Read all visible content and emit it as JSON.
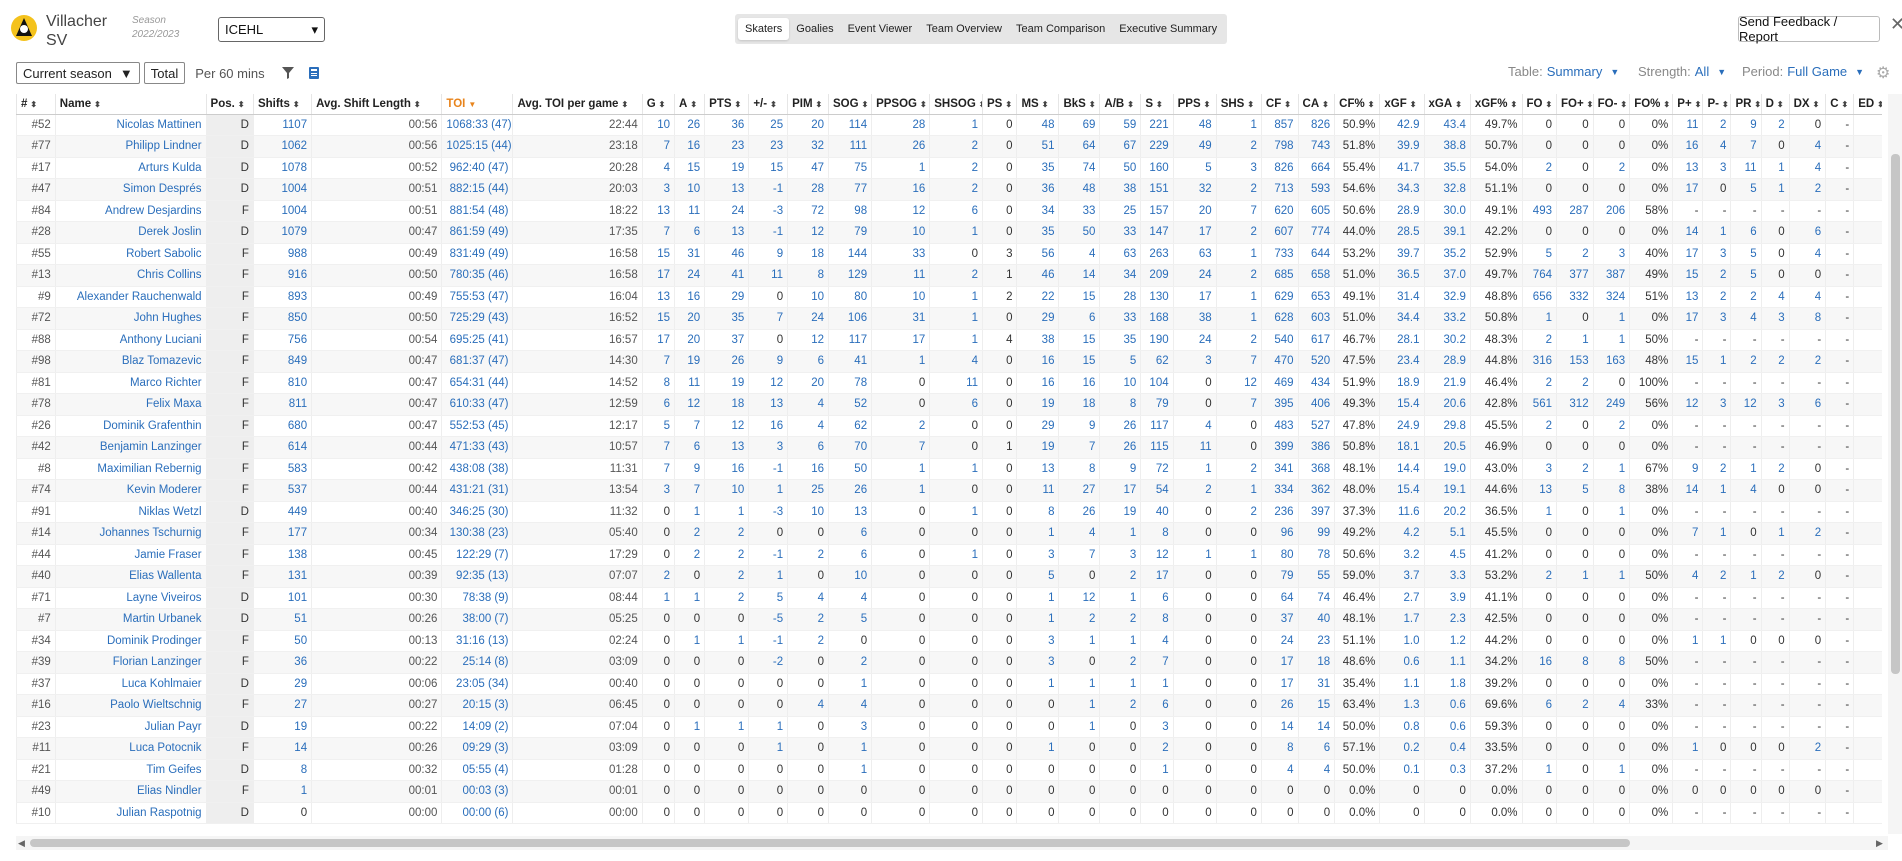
{
  "header": {
    "team_line1": "Villacher",
    "team_line2": "SV",
    "season_label": "Season",
    "season_value": "2022/2023",
    "league": "ICEHL",
    "tabs": [
      "Skaters",
      "Goalies",
      "Event Viewer",
      "Team Overview",
      "Team Comparison",
      "Executive Summary"
    ],
    "active_tab": "Skaters",
    "feedback": "Send Feedback / Report",
    "close": "✕"
  },
  "toolbar": {
    "season_filter": "Current season",
    "total": "Total",
    "per60": "Per 60 mins",
    "table_label": "Table:",
    "table_value": "Summary",
    "strength_label": "Strength:",
    "strength_value": "All",
    "period_label": "Period:",
    "period_value": "Full Game"
  },
  "columns": [
    "#",
    "Name",
    "Pos.",
    "Shifts",
    "Avg. Shift Length",
    "TOI",
    "Avg. TOI per game",
    "G",
    "A",
    "PTS",
    "+/-",
    "PIM",
    "SOG",
    "PPSOG",
    "SHSOG",
    "PS",
    "MS",
    "BkS",
    "A/B",
    "S",
    "PPS",
    "SHS",
    "CF",
    "CA",
    "CF%",
    "xGF",
    "xGA",
    "xGF%",
    "FO",
    "FO+",
    "FO-",
    "FO%",
    "P+",
    "P-",
    "PR",
    "D",
    "DX",
    "C",
    "ED"
  ],
  "rows": [
    [
      "#52",
      "Nicolas Mattinen",
      "D",
      "1107",
      "00:56",
      "1068:33 (47)",
      "22:44",
      "10",
      "26",
      "36",
      "25",
      "20",
      "114",
      "28",
      "1",
      "0",
      "48",
      "69",
      "59",
      "221",
      "48",
      "1",
      "857",
      "826",
      "50.9%",
      "42.9",
      "43.4",
      "49.7%",
      "0",
      "0",
      "0",
      "0%",
      "11",
      "2",
      "9",
      "2",
      "0",
      "-",
      ""
    ],
    [
      "#77",
      "Philipp Lindner",
      "D",
      "1062",
      "00:56",
      "1025:15 (44)",
      "23:18",
      "7",
      "16",
      "23",
      "23",
      "32",
      "111",
      "26",
      "2",
      "0",
      "51",
      "64",
      "67",
      "229",
      "49",
      "2",
      "798",
      "743",
      "51.8%",
      "39.9",
      "38.8",
      "50.7%",
      "0",
      "0",
      "0",
      "0%",
      "16",
      "4",
      "7",
      "0",
      "4",
      "-",
      ""
    ],
    [
      "#17",
      "Arturs Kulda",
      "D",
      "1078",
      "00:52",
      "962:40 (47)",
      "20:28",
      "4",
      "15",
      "19",
      "15",
      "47",
      "75",
      "1",
      "2",
      "0",
      "35",
      "74",
      "50",
      "160",
      "5",
      "3",
      "826",
      "664",
      "55.4%",
      "41.7",
      "35.5",
      "54.0%",
      "2",
      "0",
      "2",
      "0%",
      "13",
      "3",
      "11",
      "1",
      "4",
      "-",
      ""
    ],
    [
      "#47",
      "Simon Després",
      "D",
      "1004",
      "00:51",
      "882:15 (44)",
      "20:03",
      "3",
      "10",
      "13",
      "-1",
      "28",
      "77",
      "16",
      "2",
      "0",
      "36",
      "48",
      "38",
      "151",
      "32",
      "2",
      "713",
      "593",
      "54.6%",
      "34.3",
      "32.8",
      "51.1%",
      "0",
      "0",
      "0",
      "0%",
      "17",
      "0",
      "5",
      "1",
      "2",
      "-",
      ""
    ],
    [
      "#84",
      "Andrew Desjardins",
      "F",
      "1004",
      "00:51",
      "881:54 (48)",
      "18:22",
      "13",
      "11",
      "24",
      "-3",
      "72",
      "98",
      "12",
      "6",
      "0",
      "34",
      "33",
      "25",
      "157",
      "20",
      "7",
      "620",
      "605",
      "50.6%",
      "28.9",
      "30.0",
      "49.1%",
      "493",
      "287",
      "206",
      "58%",
      "-",
      "-",
      "-",
      "-",
      "-",
      "-",
      ""
    ],
    [
      "#28",
      "Derek Joslin",
      "D",
      "1079",
      "00:47",
      "861:59 (49)",
      "17:35",
      "7",
      "6",
      "13",
      "-1",
      "12",
      "79",
      "10",
      "1",
      "0",
      "35",
      "50",
      "33",
      "147",
      "17",
      "2",
      "607",
      "774",
      "44.0%",
      "28.5",
      "39.1",
      "42.2%",
      "0",
      "0",
      "0",
      "0%",
      "14",
      "1",
      "6",
      "0",
      "6",
      "-",
      ""
    ],
    [
      "#55",
      "Robert Sabolic",
      "F",
      "988",
      "00:49",
      "831:49 (49)",
      "16:58",
      "15",
      "31",
      "46",
      "9",
      "18",
      "144",
      "33",
      "0",
      "3",
      "56",
      "4",
      "63",
      "263",
      "63",
      "1",
      "733",
      "644",
      "53.2%",
      "39.7",
      "35.2",
      "52.9%",
      "5",
      "2",
      "3",
      "40%",
      "17",
      "3",
      "5",
      "0",
      "4",
      "-",
      ""
    ],
    [
      "#13",
      "Chris Collins",
      "F",
      "916",
      "00:50",
      "780:35 (46)",
      "16:58",
      "17",
      "24",
      "41",
      "11",
      "8",
      "129",
      "11",
      "2",
      "1",
      "46",
      "14",
      "34",
      "209",
      "24",
      "2",
      "685",
      "658",
      "51.0%",
      "36.5",
      "37.0",
      "49.7%",
      "764",
      "377",
      "387",
      "49%",
      "15",
      "2",
      "5",
      "0",
      "0",
      "-",
      ""
    ],
    [
      "#9",
      "Alexander Rauchenwald",
      "F",
      "893",
      "00:49",
      "755:53 (47)",
      "16:04",
      "13",
      "16",
      "29",
      "0",
      "10",
      "80",
      "10",
      "1",
      "2",
      "22",
      "15",
      "28",
      "130",
      "17",
      "1",
      "629",
      "653",
      "49.1%",
      "31.4",
      "32.9",
      "48.8%",
      "656",
      "332",
      "324",
      "51%",
      "13",
      "2",
      "2",
      "4",
      "4",
      "-",
      ""
    ],
    [
      "#72",
      "John Hughes",
      "F",
      "850",
      "00:50",
      "725:29 (43)",
      "16:52",
      "15",
      "20",
      "35",
      "7",
      "24",
      "106",
      "31",
      "1",
      "0",
      "29",
      "6",
      "33",
      "168",
      "38",
      "1",
      "628",
      "603",
      "51.0%",
      "34.4",
      "33.2",
      "50.8%",
      "1",
      "0",
      "1",
      "0%",
      "17",
      "3",
      "4",
      "3",
      "8",
      "-",
      ""
    ],
    [
      "#88",
      "Anthony Luciani",
      "F",
      "756",
      "00:54",
      "695:25 (41)",
      "16:57",
      "17",
      "20",
      "37",
      "0",
      "12",
      "117",
      "17",
      "1",
      "4",
      "38",
      "15",
      "35",
      "190",
      "24",
      "2",
      "540",
      "617",
      "46.7%",
      "28.1",
      "30.2",
      "48.3%",
      "2",
      "1",
      "1",
      "50%",
      "-",
      "-",
      "-",
      "-",
      "-",
      "-",
      ""
    ],
    [
      "#98",
      "Blaz Tomazevic",
      "F",
      "849",
      "00:47",
      "681:37 (47)",
      "14:30",
      "7",
      "19",
      "26",
      "9",
      "6",
      "41",
      "1",
      "4",
      "0",
      "16",
      "15",
      "5",
      "62",
      "3",
      "7",
      "470",
      "520",
      "47.5%",
      "23.4",
      "28.9",
      "44.8%",
      "316",
      "153",
      "163",
      "48%",
      "15",
      "1",
      "2",
      "2",
      "2",
      "-",
      ""
    ],
    [
      "#81",
      "Marco Richter",
      "F",
      "810",
      "00:47",
      "654:31 (44)",
      "14:52",
      "8",
      "11",
      "19",
      "12",
      "20",
      "78",
      "0",
      "11",
      "0",
      "16",
      "16",
      "10",
      "104",
      "0",
      "12",
      "469",
      "434",
      "51.9%",
      "18.9",
      "21.9",
      "46.4%",
      "2",
      "2",
      "0",
      "100%",
      "-",
      "-",
      "-",
      "-",
      "-",
      "-",
      ""
    ],
    [
      "#78",
      "Felix Maxa",
      "F",
      "811",
      "00:47",
      "610:33 (47)",
      "12:59",
      "6",
      "12",
      "18",
      "13",
      "4",
      "52",
      "0",
      "6",
      "0",
      "19",
      "18",
      "8",
      "79",
      "0",
      "7",
      "395",
      "406",
      "49.3%",
      "15.4",
      "20.6",
      "42.8%",
      "561",
      "312",
      "249",
      "56%",
      "12",
      "3",
      "12",
      "3",
      "6",
      "-",
      ""
    ],
    [
      "#26",
      "Dominik Grafenthin",
      "F",
      "680",
      "00:47",
      "552:53 (45)",
      "12:17",
      "5",
      "7",
      "12",
      "16",
      "4",
      "62",
      "2",
      "0",
      "0",
      "29",
      "9",
      "26",
      "117",
      "4",
      "0",
      "483",
      "527",
      "47.8%",
      "24.9",
      "29.8",
      "45.5%",
      "2",
      "0",
      "2",
      "0%",
      "-",
      "-",
      "-",
      "-",
      "-",
      "-",
      ""
    ],
    [
      "#42",
      "Benjamin Lanzinger",
      "F",
      "614",
      "00:44",
      "471:33 (43)",
      "10:57",
      "7",
      "6",
      "13",
      "3",
      "6",
      "70",
      "7",
      "0",
      "1",
      "19",
      "7",
      "26",
      "115",
      "11",
      "0",
      "399",
      "386",
      "50.8%",
      "18.1",
      "20.5",
      "46.9%",
      "0",
      "0",
      "0",
      "0%",
      "-",
      "-",
      "-",
      "-",
      "-",
      "-",
      ""
    ],
    [
      "#8",
      "Maximilian Rebernig",
      "F",
      "583",
      "00:42",
      "438:08 (38)",
      "11:31",
      "7",
      "9",
      "16",
      "-1",
      "16",
      "50",
      "1",
      "1",
      "0",
      "13",
      "8",
      "9",
      "72",
      "1",
      "2",
      "341",
      "368",
      "48.1%",
      "14.4",
      "19.0",
      "43.0%",
      "3",
      "2",
      "1",
      "67%",
      "9",
      "2",
      "1",
      "2",
      "0",
      "-",
      ""
    ],
    [
      "#74",
      "Kevin Moderer",
      "F",
      "537",
      "00:44",
      "431:21 (31)",
      "13:54",
      "3",
      "7",
      "10",
      "1",
      "25",
      "26",
      "1",
      "0",
      "0",
      "11",
      "27",
      "17",
      "54",
      "2",
      "1",
      "334",
      "362",
      "48.0%",
      "15.4",
      "19.1",
      "44.6%",
      "13",
      "5",
      "8",
      "38%",
      "14",
      "1",
      "4",
      "0",
      "0",
      "-",
      ""
    ],
    [
      "#91",
      "Niklas Wetzl",
      "D",
      "449",
      "00:40",
      "346:25 (30)",
      "11:32",
      "0",
      "1",
      "1",
      "-3",
      "10",
      "13",
      "0",
      "1",
      "0",
      "8",
      "26",
      "19",
      "40",
      "0",
      "2",
      "236",
      "397",
      "37.3%",
      "11.6",
      "20.2",
      "36.5%",
      "1",
      "0",
      "1",
      "0%",
      "-",
      "-",
      "-",
      "-",
      "-",
      "-",
      ""
    ],
    [
      "#14",
      "Johannes Tschurnig",
      "F",
      "177",
      "00:34",
      "130:38 (23)",
      "05:40",
      "0",
      "2",
      "2",
      "0",
      "0",
      "6",
      "0",
      "0",
      "0",
      "1",
      "4",
      "1",
      "8",
      "0",
      "0",
      "96",
      "99",
      "49.2%",
      "4.2",
      "5.1",
      "45.5%",
      "0",
      "0",
      "0",
      "0%",
      "7",
      "1",
      "0",
      "1",
      "2",
      "-",
      ""
    ],
    [
      "#44",
      "Jamie Fraser",
      "F",
      "138",
      "00:45",
      "122:29 (7)",
      "17:29",
      "0",
      "2",
      "2",
      "-1",
      "2",
      "6",
      "0",
      "1",
      "0",
      "3",
      "7",
      "3",
      "12",
      "1",
      "1",
      "80",
      "78",
      "50.6%",
      "3.2",
      "4.5",
      "41.2%",
      "0",
      "0",
      "0",
      "0%",
      "-",
      "-",
      "-",
      "-",
      "-",
      "-",
      ""
    ],
    [
      "#40",
      "Elias Wallenta",
      "F",
      "131",
      "00:39",
      "92:35 (13)",
      "07:07",
      "2",
      "0",
      "2",
      "1",
      "0",
      "10",
      "0",
      "0",
      "0",
      "5",
      "0",
      "2",
      "17",
      "0",
      "0",
      "79",
      "55",
      "59.0%",
      "3.7",
      "3.3",
      "53.2%",
      "2",
      "1",
      "1",
      "50%",
      "4",
      "2",
      "1",
      "2",
      "0",
      "-",
      ""
    ],
    [
      "#71",
      "Layne Viveiros",
      "D",
      "101",
      "00:30",
      "78:38 (9)",
      "08:44",
      "1",
      "1",
      "2",
      "5",
      "4",
      "4",
      "0",
      "0",
      "0",
      "1",
      "12",
      "1",
      "6",
      "0",
      "0",
      "64",
      "74",
      "46.4%",
      "2.7",
      "3.9",
      "41.1%",
      "0",
      "0",
      "0",
      "0%",
      "-",
      "-",
      "-",
      "-",
      "-",
      "-",
      ""
    ],
    [
      "#7",
      "Martin Urbanek",
      "D",
      "51",
      "00:26",
      "38:00 (7)",
      "05:25",
      "0",
      "0",
      "0",
      "-5",
      "2",
      "5",
      "0",
      "0",
      "0",
      "1",
      "2",
      "2",
      "8",
      "0",
      "0",
      "37",
      "40",
      "48.1%",
      "1.7",
      "2.3",
      "42.5%",
      "0",
      "0",
      "0",
      "0%",
      "-",
      "-",
      "-",
      "-",
      "-",
      "-",
      ""
    ],
    [
      "#34",
      "Dominik Prodinger",
      "F",
      "50",
      "00:13",
      "31:16 (13)",
      "02:24",
      "0",
      "1",
      "1",
      "-1",
      "2",
      "0",
      "0",
      "0",
      "0",
      "3",
      "1",
      "1",
      "4",
      "0",
      "0",
      "24",
      "23",
      "51.1%",
      "1.0",
      "1.2",
      "44.2%",
      "0",
      "0",
      "0",
      "0%",
      "1",
      "1",
      "0",
      "0",
      "0",
      "-",
      ""
    ],
    [
      "#39",
      "Florian Lanzinger",
      "F",
      "36",
      "00:22",
      "25:14 (8)",
      "03:09",
      "0",
      "0",
      "0",
      "-2",
      "0",
      "2",
      "0",
      "0",
      "0",
      "3",
      "0",
      "2",
      "7",
      "0",
      "0",
      "17",
      "18",
      "48.6%",
      "0.6",
      "1.1",
      "34.2%",
      "16",
      "8",
      "8",
      "50%",
      "-",
      "-",
      "-",
      "-",
      "-",
      "-",
      ""
    ],
    [
      "#37",
      "Luca Kohlmaier",
      "D",
      "29",
      "00:06",
      "23:05 (34)",
      "00:40",
      "0",
      "0",
      "0",
      "0",
      "0",
      "1",
      "0",
      "0",
      "0",
      "1",
      "1",
      "1",
      "1",
      "0",
      "0",
      "17",
      "31",
      "35.4%",
      "1.1",
      "1.8",
      "39.2%",
      "0",
      "0",
      "0",
      "0%",
      "-",
      "-",
      "-",
      "-",
      "-",
      "-",
      ""
    ],
    [
      "#16",
      "Paolo Wieltschnig",
      "F",
      "27",
      "00:27",
      "20:15 (3)",
      "06:45",
      "0",
      "0",
      "0",
      "0",
      "4",
      "4",
      "0",
      "0",
      "0",
      "0",
      "1",
      "2",
      "6",
      "0",
      "0",
      "26",
      "15",
      "63.4%",
      "1.3",
      "0.6",
      "69.6%",
      "6",
      "2",
      "4",
      "33%",
      "-",
      "-",
      "-",
      "-",
      "-",
      "-",
      ""
    ],
    [
      "#23",
      "Julian Payr",
      "D",
      "19",
      "00:22",
      "14:09 (2)",
      "07:04",
      "0",
      "1",
      "1",
      "1",
      "0",
      "3",
      "0",
      "0",
      "0",
      "0",
      "1",
      "0",
      "3",
      "0",
      "0",
      "14",
      "14",
      "50.0%",
      "0.8",
      "0.6",
      "59.3%",
      "0",
      "0",
      "0",
      "0%",
      "-",
      "-",
      "-",
      "-",
      "-",
      "-",
      ""
    ],
    [
      "#11",
      "Luca Potocnik",
      "F",
      "14",
      "00:26",
      "09:29 (3)",
      "03:09",
      "0",
      "0",
      "0",
      "1",
      "0",
      "1",
      "0",
      "0",
      "0",
      "1",
      "0",
      "0",
      "2",
      "0",
      "0",
      "8",
      "6",
      "57.1%",
      "0.2",
      "0.4",
      "33.5%",
      "0",
      "0",
      "0",
      "0%",
      "1",
      "0",
      "0",
      "0",
      "2",
      "-",
      ""
    ],
    [
      "#21",
      "Tim Geifes",
      "D",
      "8",
      "00:32",
      "05:55 (4)",
      "01:28",
      "0",
      "0",
      "0",
      "0",
      "0",
      "1",
      "0",
      "0",
      "0",
      "0",
      "0",
      "0",
      "1",
      "0",
      "0",
      "4",
      "4",
      "50.0%",
      "0.1",
      "0.3",
      "37.2%",
      "1",
      "0",
      "1",
      "0%",
      "-",
      "-",
      "-",
      "-",
      "-",
      "-",
      ""
    ],
    [
      "#49",
      "Elias Nindler",
      "F",
      "1",
      "00:01",
      "00:03 (3)",
      "00:01",
      "0",
      "0",
      "0",
      "0",
      "0",
      "0",
      "0",
      "0",
      "0",
      "0",
      "0",
      "0",
      "0",
      "0",
      "0",
      "0",
      "0",
      "0.0%",
      "0",
      "0",
      "0.0%",
      "0",
      "0",
      "0",
      "0%",
      "0",
      "0",
      "0",
      "0",
      "0",
      "-",
      ""
    ],
    [
      "#10",
      "Julian Raspotnig",
      "D",
      "0",
      "00:00",
      "00:00 (6)",
      "00:00",
      "0",
      "0",
      "0",
      "0",
      "0",
      "0",
      "0",
      "0",
      "0",
      "0",
      "0",
      "0",
      "0",
      "0",
      "0",
      "0",
      "0",
      "0.0%",
      "0",
      "0",
      "0.0%",
      "0",
      "0",
      "0",
      "0%",
      "-",
      "-",
      "-",
      "-",
      "-",
      "-",
      ""
    ]
  ]
}
